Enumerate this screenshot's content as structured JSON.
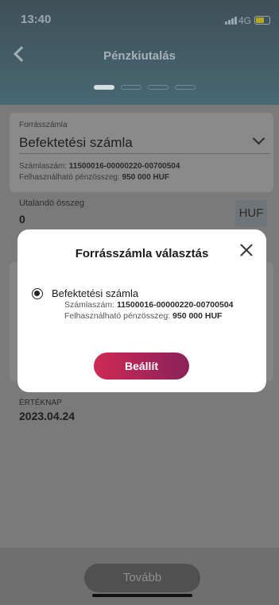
{
  "status_bar": {
    "time": "13:40",
    "network": "4G",
    "signal_level": 1.0,
    "battery_level": 0.5
  },
  "header": {
    "title": "Pénzkiutalás",
    "steps_total": 4,
    "steps_active": 1
  },
  "form": {
    "source_label": "Forrásszámla",
    "source_value": "Befektetési számla",
    "account_label": "Számlaszám:",
    "account_number": "11500016-00000220-00700504",
    "available_label": "Felhasználható pénzösszeg:",
    "available_amount": "950 000 HUF",
    "amount_label": "Utalandó összeg",
    "amount_value": "0",
    "currency": "HUF",
    "value_date_label": "ÉRTÉKNAP",
    "value_date": "2023.04.24"
  },
  "modal": {
    "title": "Forrásszámla választás",
    "option_name": "Befektetési számla",
    "account_label": "Számlaszám:",
    "account_number": "11500016-00000220-00700504",
    "available_label": "Felhasználható pénzösszeg:",
    "available_amount": "950 000 HUF",
    "set_button": "Beállít"
  },
  "footer": {
    "next_button": "Tovább"
  },
  "colors": {
    "accent_start": "#cf2a55",
    "accent_end": "#8a2159",
    "header": "#17465a"
  }
}
